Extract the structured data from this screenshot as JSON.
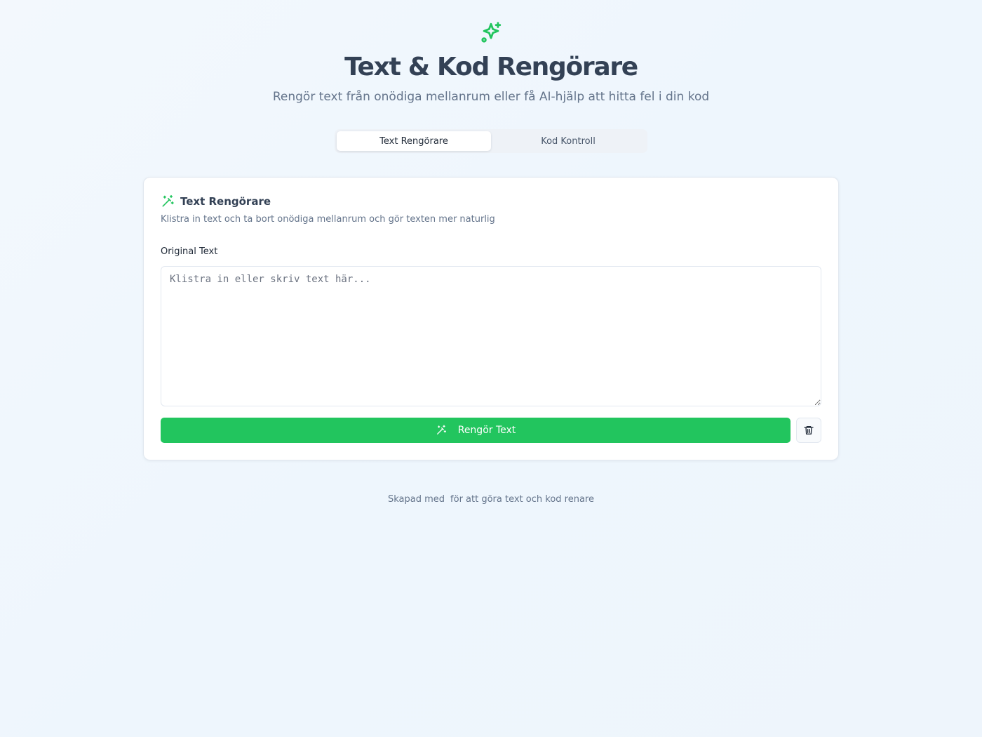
{
  "header": {
    "icon": "sparkles-icon",
    "title": "Text & Kod Rengörare",
    "subtitle": "Rengör text från onödiga mellanrum eller få AI-hjälp att hitta fel i din kod"
  },
  "tabs": [
    {
      "label": "Text Rengörare",
      "active": true
    },
    {
      "label": "Kod Kontroll",
      "active": false
    }
  ],
  "card": {
    "icon": "magic-wand-icon",
    "title": "Text Rengörare",
    "description": "Klistra in text och ta bort onödiga mellanrum och gör texten mer naturlig",
    "field_label": "Original Text",
    "textarea": {
      "value": "",
      "placeholder": "Klistra in eller skriv text här..."
    },
    "clean_button_label": "Rengör Text",
    "trash_icon": "trash-icon"
  },
  "footer": {
    "before": "Skapad med",
    "heart_glyph": "",
    "after": "för att göra text och kod renare"
  },
  "colors": {
    "accent": "#22c55e",
    "title": "#334155",
    "muted": "#64748b"
  }
}
